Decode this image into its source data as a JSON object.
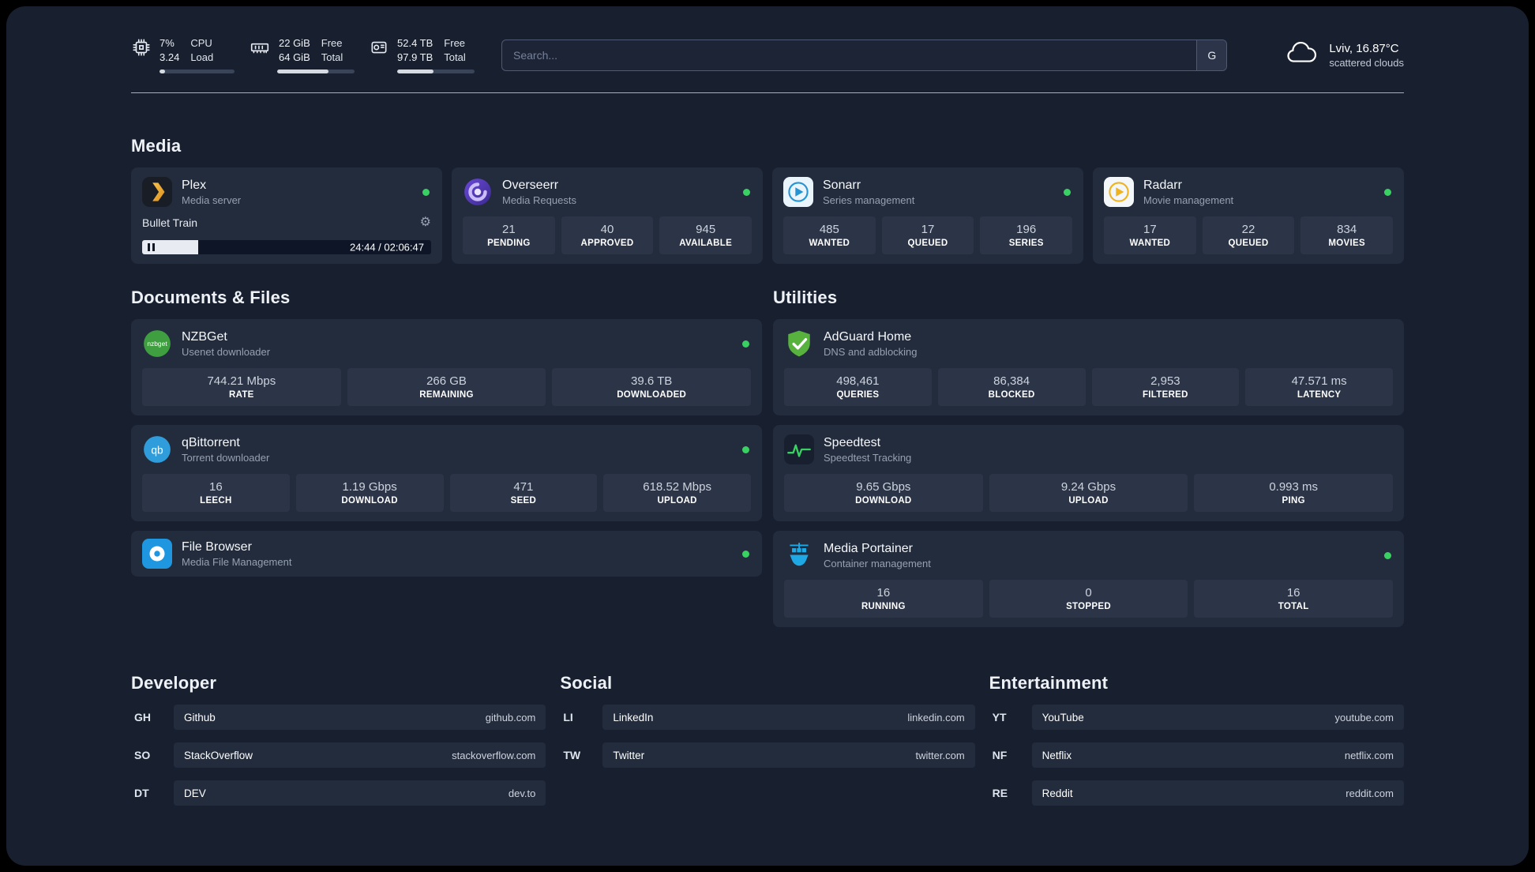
{
  "colors": {
    "status_online": "#3ad163",
    "bar_fill": "#d6dbe3"
  },
  "header": {
    "cpu": {
      "value": "7%",
      "sub": "3.24",
      "label": "CPU",
      "sublabel": "Load",
      "bar": 7
    },
    "ram": {
      "value": "22 GiB",
      "sub": "64 GiB",
      "label": "Free",
      "sublabel": "Total",
      "bar": 66
    },
    "disk": {
      "value": "52.4 TB",
      "sub": "97.9 TB",
      "label": "Free",
      "sublabel": "Total",
      "bar": 47
    },
    "search": {
      "placeholder": "Search...",
      "engine_label": "G"
    },
    "weather": {
      "location": "Lviv, 16.87°C",
      "condition": "scattered clouds"
    }
  },
  "sections": {
    "media": "Media",
    "documents": "Documents & Files",
    "utilities": "Utilities",
    "developer": "Developer",
    "social": "Social",
    "entertainment": "Entertainment"
  },
  "apps": {
    "plex": {
      "name": "Plex",
      "desc": "Media server",
      "now_playing": "Bullet Train",
      "time": "24:44 / 02:06:47",
      "progress_percent": 19.5
    },
    "overseerr": {
      "name": "Overseerr",
      "desc": "Media Requests",
      "stats": [
        {
          "value": "21",
          "label": "PENDING"
        },
        {
          "value": "40",
          "label": "APPROVED"
        },
        {
          "value": "945",
          "label": "AVAILABLE"
        }
      ]
    },
    "sonarr": {
      "name": "Sonarr",
      "desc": "Series management",
      "stats": [
        {
          "value": "485",
          "label": "WANTED"
        },
        {
          "value": "17",
          "label": "QUEUED"
        },
        {
          "value": "196",
          "label": "SERIES"
        }
      ]
    },
    "radarr": {
      "name": "Radarr",
      "desc": "Movie management",
      "stats": [
        {
          "value": "17",
          "label": "WANTED"
        },
        {
          "value": "22",
          "label": "QUEUED"
        },
        {
          "value": "834",
          "label": "MOVIES"
        }
      ]
    },
    "nzbget": {
      "name": "NZBGet",
      "desc": "Usenet downloader",
      "stats": [
        {
          "value": "744.21 Mbps",
          "label": "RATE"
        },
        {
          "value": "266 GB",
          "label": "REMAINING"
        },
        {
          "value": "39.6 TB",
          "label": "DOWNLOADED"
        }
      ]
    },
    "qbittorrent": {
      "name": "qBittorrent",
      "desc": "Torrent downloader",
      "stats": [
        {
          "value": "16",
          "label": "LEECH"
        },
        {
          "value": "1.19 Gbps",
          "label": "DOWNLOAD"
        },
        {
          "value": "471",
          "label": "SEED"
        },
        {
          "value": "618.52 Mbps",
          "label": "UPLOAD"
        }
      ]
    },
    "filebrowser": {
      "name": "File Browser",
      "desc": "Media File Management"
    },
    "adguard": {
      "name": "AdGuard Home",
      "desc": "DNS and adblocking",
      "stats": [
        {
          "value": "498,461",
          "label": "QUERIES"
        },
        {
          "value": "86,384",
          "label": "BLOCKED"
        },
        {
          "value": "2,953",
          "label": "FILTERED"
        },
        {
          "value": "47.571 ms",
          "label": "LATENCY"
        }
      ]
    },
    "speedtest": {
      "name": "Speedtest",
      "desc": "Speedtest Tracking",
      "stats": [
        {
          "value": "9.65 Gbps",
          "label": "DOWNLOAD"
        },
        {
          "value": "9.24 Gbps",
          "label": "UPLOAD"
        },
        {
          "value": "0.993 ms",
          "label": "PING"
        }
      ]
    },
    "portainer": {
      "name": "Media Portainer",
      "desc": "Container management",
      "stats": [
        {
          "value": "16",
          "label": "RUNNING"
        },
        {
          "value": "0",
          "label": "STOPPED"
        },
        {
          "value": "16",
          "label": "TOTAL"
        }
      ]
    }
  },
  "links": {
    "developer": [
      {
        "abbr": "GH",
        "name": "Github",
        "url": "github.com"
      },
      {
        "abbr": "SO",
        "name": "StackOverflow",
        "url": "stackoverflow.com"
      },
      {
        "abbr": "DT",
        "name": "DEV",
        "url": "dev.to"
      }
    ],
    "social": [
      {
        "abbr": "LI",
        "name": "LinkedIn",
        "url": "linkedin.com"
      },
      {
        "abbr": "TW",
        "name": "Twitter",
        "url": "twitter.com"
      }
    ],
    "entertainment": [
      {
        "abbr": "YT",
        "name": "YouTube",
        "url": "youtube.com"
      },
      {
        "abbr": "NF",
        "name": "Netflix",
        "url": "netflix.com"
      },
      {
        "abbr": "RE",
        "name": "Reddit",
        "url": "reddit.com"
      }
    ]
  }
}
